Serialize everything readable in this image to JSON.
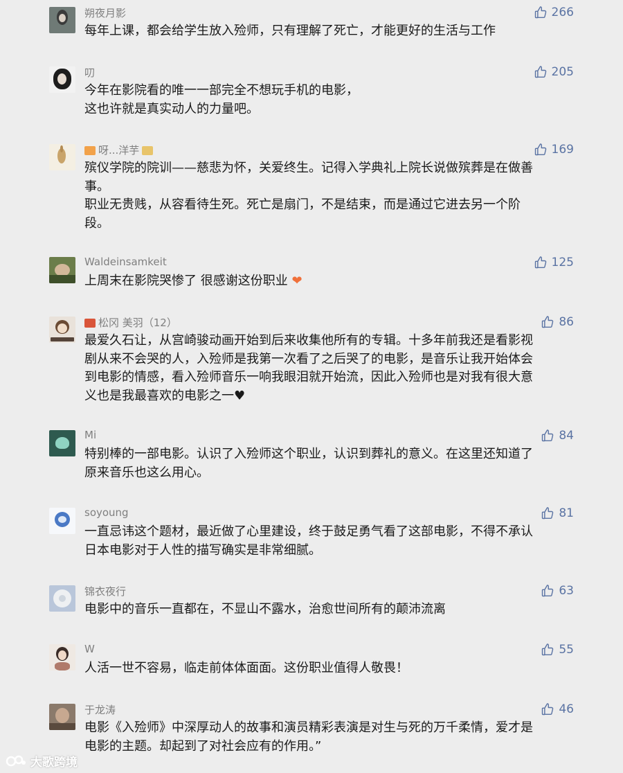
{
  "comments": [
    {
      "nickname": "朔夜月影",
      "likes": "266",
      "lines": [
        "每年上课，都会给学生放入殓师，只有理解了死亡，才能更好的生活与工作"
      ]
    },
    {
      "nickname": "叨",
      "likes": "205",
      "lines": [
        "今年在影院看的唯一一部完全不想玩手机的电影，",
        "这也许就是真实动人的力量吧。"
      ]
    },
    {
      "nickname": "呀...洋芋",
      "likes": "169",
      "lines": [
        "殡仪学院的院训——慈悲为怀，关爱终生。记得入学典礼上院长说做殡葬是在做善",
        "事。",
        "职业无贵贱，从容看待生死。死亡是扇门，不是结束，而是通过它进去另一个阶",
        "段。"
      ]
    },
    {
      "nickname": "Waldeinsamkeit",
      "likes": "125",
      "lines": [
        "上周末在影院哭惨了 很感谢这份职业"
      ]
    },
    {
      "nickname": "松冈 美羽（12）",
      "likes": "86",
      "lines": [
        "最爱久石让，从宫崎骏动画开始到后来收集他所有的专辑。十多年前我还是看影视",
        "剧从来不会哭的人，入殓师是我第一次看了之后哭了的电影，是音乐让我开始体会",
        "到电影的情感，看入殓师音乐一响我眼泪就开始流，因此入殓师也是对我有很大意",
        "义也是我最喜欢的电影之一♥"
      ]
    },
    {
      "nickname": "Mi",
      "likes": "84",
      "lines": [
        "特别棒的一部电影。认识了入殓师这个职业，认识到葬礼的意义。在这里还知道了",
        "原来音乐也这么用心。"
      ]
    },
    {
      "nickname": "soyoung",
      "likes": "81",
      "lines": [
        "一直忌讳这个题材，最近做了心里建设，终于鼓足勇气看了这部电影，不得不承认",
        "日本电影对于人性的描写确实是非常细腻。"
      ]
    },
    {
      "nickname": "锦衣夜行",
      "likes": "63",
      "lines": [
        "电影中的音乐一直都在，不显山不露水，治愈世间所有的颠沛流离"
      ]
    },
    {
      "nickname": "W",
      "likes": "55",
      "lines": [
        "人活一世不容易，临走前体体面面。这份职业值得人敬畏！"
      ]
    },
    {
      "nickname": "于龙涛",
      "likes": "46",
      "lines": [
        "电影《入殓师》中深厚动人的故事和演员精彩表演是对生与死的万千柔情，爱才是",
        "电影的主题。却起到了对社会应有的作用。”"
      ]
    }
  ],
  "watermark": "大歌跨境",
  "colors": {
    "background": "#ededed",
    "nickname": "#7f7f7f",
    "like": "#5a73a3",
    "text": "#1a1a1a"
  },
  "icons": {
    "like": "thumbs-up-icon",
    "avatar": "user-avatar"
  }
}
